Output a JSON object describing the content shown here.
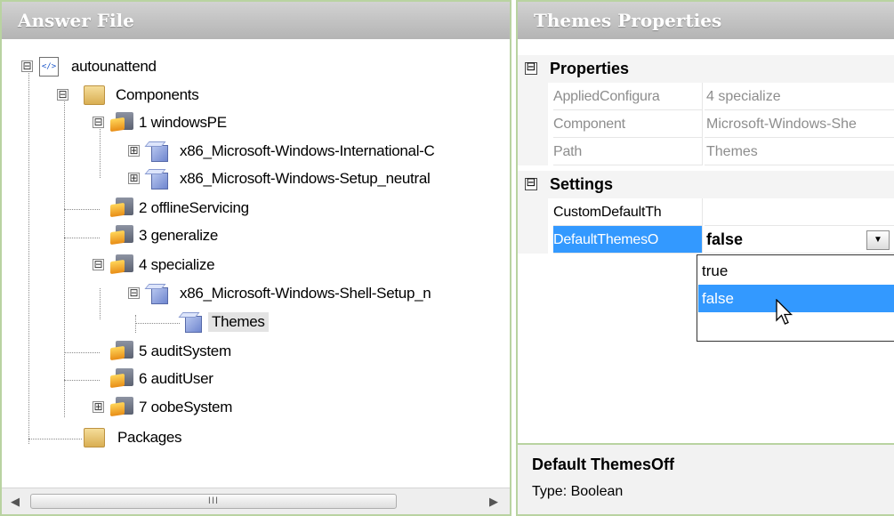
{
  "answer_file": {
    "title": "Answer File",
    "nodes": [
      {
        "label": "autounattend",
        "icon": "xml-file-icon",
        "expander": "⊟"
      },
      {
        "label": "Components",
        "icon": "folder-icon",
        "expander": "⊟"
      },
      {
        "label": "1 windowsPE",
        "icon": "configuration-pass-icon",
        "expander": "⊟"
      },
      {
        "label": "x86_Microsoft-Windows-International-C",
        "icon": "component-cube-icon",
        "expander": "⊞"
      },
      {
        "label": "x86_Microsoft-Windows-Setup_neutral",
        "icon": "component-cube-icon",
        "expander": "⊞"
      },
      {
        "label": "2 offlineServicing",
        "icon": "configuration-pass-icon",
        "expander": ""
      },
      {
        "label": "3 generalize",
        "icon": "configuration-pass-icon",
        "expander": ""
      },
      {
        "label": "4 specialize",
        "icon": "configuration-pass-icon",
        "expander": "⊟"
      },
      {
        "label": "x86_Microsoft-Windows-Shell-Setup_n",
        "icon": "component-cube-icon",
        "expander": "⊟"
      },
      {
        "label": "Themes",
        "icon": "component-cube-icon",
        "expander": ""
      },
      {
        "label": "5 auditSystem",
        "icon": "configuration-pass-icon",
        "expander": ""
      },
      {
        "label": "6 auditUser",
        "icon": "configuration-pass-icon",
        "expander": ""
      },
      {
        "label": "7 oobeSystem",
        "icon": "configuration-pass-icon",
        "expander": "⊞"
      },
      {
        "label": "Packages",
        "icon": "folder-icon",
        "expander": ""
      }
    ],
    "selected": "Themes",
    "scrollbar": {
      "left_arrow": "◀",
      "right_arrow": "▶",
      "grip": "III"
    }
  },
  "properties": {
    "title": "Themes Properties",
    "categories": {
      "properties": {
        "label": "Properties",
        "toggle": "⊟"
      },
      "settings": {
        "label": "Settings",
        "toggle": "⊟"
      }
    },
    "rows": {
      "applied_configuration": {
        "name": "AppliedConfigura",
        "value": "4 specialize"
      },
      "component": {
        "name": "Component",
        "value": "Microsoft-Windows-She"
      },
      "path": {
        "name": "Path",
        "value": "Themes"
      },
      "custom_default": {
        "name": "CustomDefaultTh",
        "value": ""
      },
      "default_themes_off": {
        "name": "DefaultThemesO",
        "value": "false"
      }
    },
    "dropdown": {
      "button_glyph": "▼",
      "options": [
        "true",
        "false"
      ],
      "highlighted": "false"
    },
    "description": {
      "title": "Default ThemesOff",
      "text": "Type: Boolean"
    }
  },
  "colors": {
    "selection": "#3399ff",
    "panel_border": "#b9d3a1",
    "header_gradient_top": "#d2d2d2",
    "header_gradient_bottom": "#b4b4b4"
  }
}
